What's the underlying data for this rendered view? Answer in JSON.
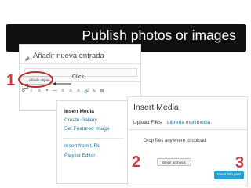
{
  "slide": {
    "title": "Publish photos or images"
  },
  "editor": {
    "page_title": "Añadir nueva entrada",
    "add_media_label": "Añadir objeto",
    "click_label": "Click",
    "toolbar_buttons": [
      "B",
      "I",
      "≡",
      "❝",
      "—",
      "≡",
      "≡",
      "≡",
      "🔗",
      "✎",
      "⊞"
    ]
  },
  "menu": {
    "heading": "Insert Media",
    "items": [
      "Create Gallery",
      "Set Featured Image",
      "Insert from URL",
      "Playlist Editor"
    ]
  },
  "dialog": {
    "title": "Insert Media",
    "tabs": [
      "Upload Files",
      "Librería multimedia"
    ],
    "drop_text": "Drop files anywhere to upload",
    "select_files_label": "Elegir archivos",
    "insert_button_label": "Insert into post"
  },
  "steps": [
    "1",
    "2",
    "3"
  ],
  "colors": {
    "accent": "#2e9fd1",
    "link": "#21759b",
    "step": "#d13a3a",
    "title_bar": "#101010"
  }
}
